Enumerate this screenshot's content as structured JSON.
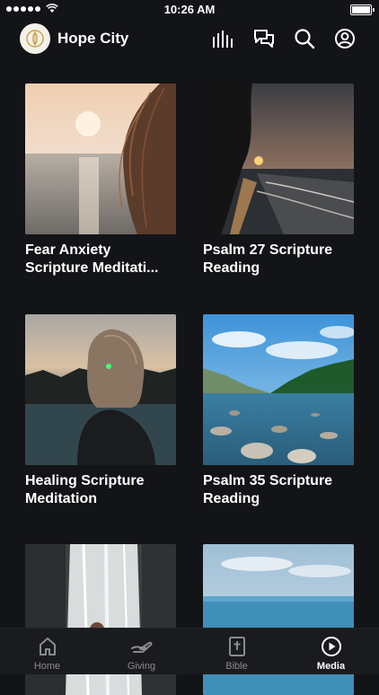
{
  "status": {
    "time": "10:26 AM"
  },
  "header": {
    "title": "Hope City"
  },
  "media": [
    {
      "title": "Fear Anxiety Scripture Meditati..."
    },
    {
      "title": "Psalm 27 Scripture Reading"
    },
    {
      "title": "Healing Scripture Meditation"
    },
    {
      "title": "Psalm 35 Scripture Reading"
    }
  ],
  "tabs": [
    {
      "label": "Home",
      "icon": "home-icon"
    },
    {
      "label": "Giving",
      "icon": "giving-hands-icon"
    },
    {
      "label": "Bible",
      "icon": "bible-icon"
    },
    {
      "label": "Media",
      "icon": "play-circle-icon",
      "active": true
    }
  ]
}
